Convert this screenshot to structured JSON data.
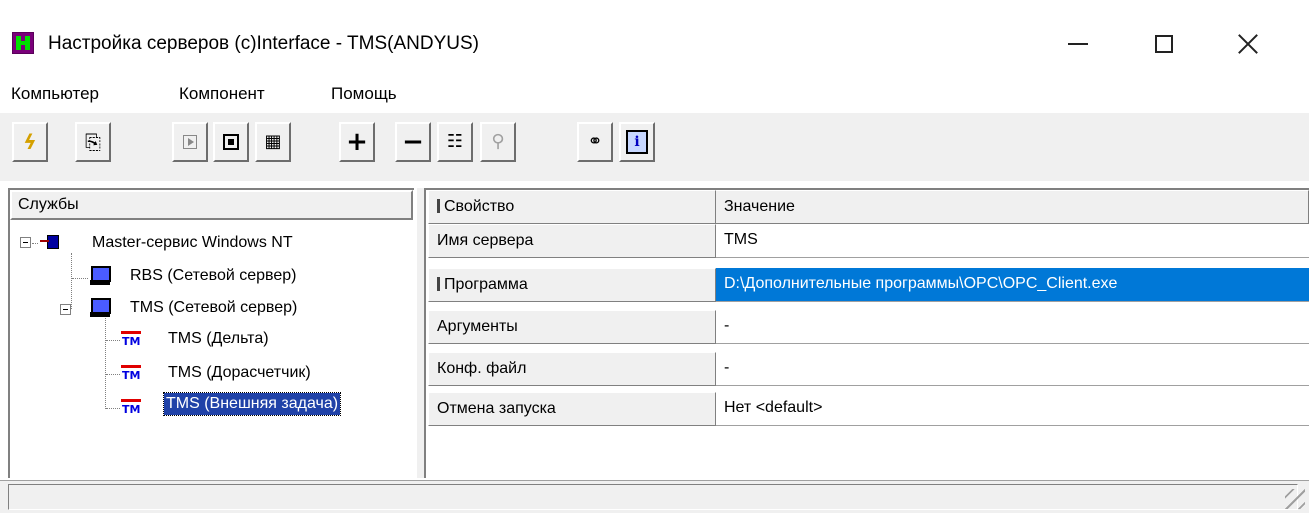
{
  "window": {
    "title": "Настройка серверов (c)Interface - TMS(ANDYUS)",
    "minimize_icon": "minimize-icon",
    "maximize_icon": "maximize-icon",
    "close_icon": "close-icon"
  },
  "menu": {
    "items": [
      "Компьютер",
      "Компонент",
      "Помощь"
    ]
  },
  "toolbar": {
    "buttons": [
      {
        "icon": "run-lightning-icon",
        "enabled": true
      },
      {
        "icon": "export-icon",
        "enabled": true
      },
      {
        "icon": "start-icon",
        "enabled": false
      },
      {
        "icon": "stop-icon",
        "enabled": true
      },
      {
        "icon": "services-icon",
        "enabled": true
      },
      {
        "icon": "add-icon",
        "enabled": true
      },
      {
        "icon": "remove-icon",
        "enabled": true
      },
      {
        "icon": "properties-icon",
        "enabled": true
      },
      {
        "icon": "find-icon",
        "enabled": false
      },
      {
        "icon": "connect-icon",
        "enabled": true
      },
      {
        "icon": "info-icon",
        "enabled": true
      }
    ]
  },
  "tree": {
    "header": "Службы",
    "nodes": [
      {
        "label": "Master-сервис Windows NT",
        "icon": "network-icon",
        "level": 0,
        "expanded": true
      },
      {
        "label": "RBS (Сетевой сервер)",
        "icon": "computer-icon",
        "level": 1
      },
      {
        "label": "TMS (Сетевой сервер)",
        "icon": "computer-icon",
        "level": 1,
        "expanded": true
      },
      {
        "label": "TMS (Дельта)",
        "icon": "tm-icon",
        "level": 2
      },
      {
        "label": "TMS (Дорасчетчик)",
        "icon": "tm-icon",
        "level": 2
      },
      {
        "label": "TMS (Внешняя задача)",
        "icon": "tm-icon",
        "level": 2,
        "selected": true
      }
    ]
  },
  "grid": {
    "columns": [
      "Свойство",
      "Значение"
    ],
    "rows": [
      {
        "property": "Имя сервера",
        "value": "TMS"
      },
      {
        "property": "Программа",
        "value": "D:\\Дополнительные программы\\OPC\\OPC_Client.exe",
        "selected": true
      },
      {
        "property": "Аргументы",
        "value": "-"
      },
      {
        "property": "Конф. файл",
        "value": "-"
      },
      {
        "property": "Отмена запуска",
        "value": "Нет <default>"
      }
    ]
  },
  "colors": {
    "selection": "#0078d7",
    "tree_selection": "#2042a8",
    "chrome": "#f0f0f0"
  }
}
